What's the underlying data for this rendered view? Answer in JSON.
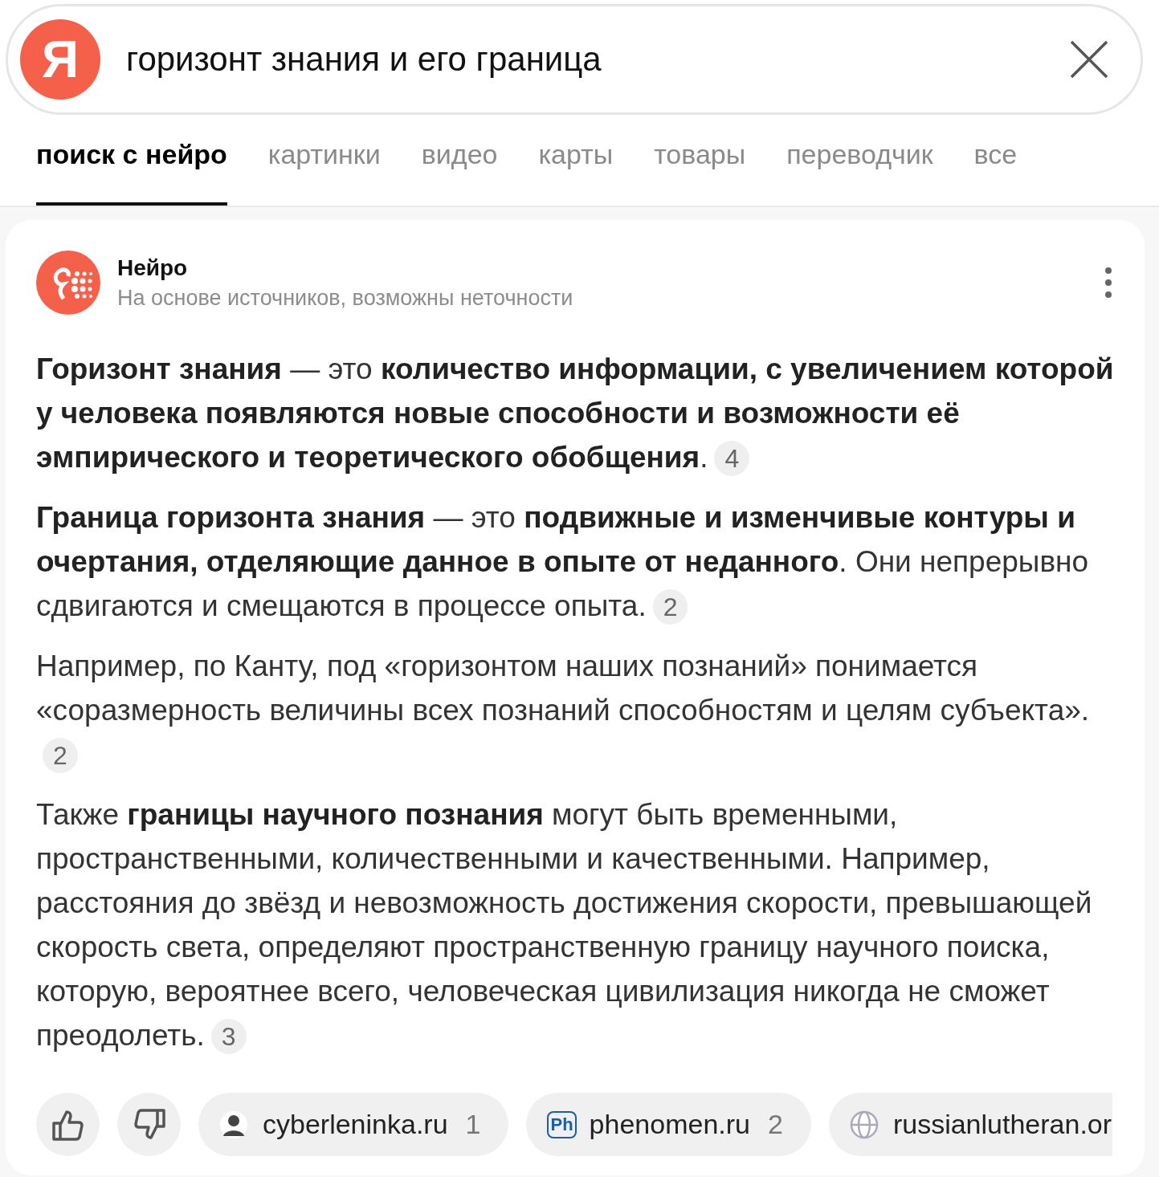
{
  "search": {
    "logo": "Я",
    "query": "горизонт знания и его граница"
  },
  "tabs": [
    {
      "label": "поиск с нейро",
      "selected": true
    },
    {
      "label": "картинки",
      "selected": false
    },
    {
      "label": "видео",
      "selected": false
    },
    {
      "label": "карты",
      "selected": false
    },
    {
      "label": "товары",
      "selected": false
    },
    {
      "label": "переводчик",
      "selected": false
    },
    {
      "label": "все",
      "selected": false
    }
  ],
  "answer": {
    "title": "Нейро",
    "subtitle": "На основе источников, возможны неточности",
    "paragraphs": [
      {
        "text": "**Горизонт знания** — это **количество информации, с увеличением которой у человека появляются новые способности и возможности её эмпирического и теоретического обобщения**.",
        "citation": "4"
      },
      {
        "text": "**Граница горизонта знания** — это **подвижные и изменчивые контуры и очертания, отделяющие данное в опыте от неданного**. Они непрерывно сдвигаются и смещаются в процессе опыта.",
        "citation": "2"
      },
      {
        "text": "Например, по Канту, под «горизонтом наших познаний» понимается «соразмерность величины всех познаний способностям и целям субъекта».",
        "citation": "2"
      },
      {
        "text": "Также **границы научного познания** могут быть временными, пространственными, количественными и качественными. Например, расстояния до звёзд и невозможность достижения скорости, превышающей скорость света, определяют пространственную границу научного поиска, которую, вероятнее всего, человеческая цивилизация никогда не сможет преодолеть.",
        "citation": "3"
      }
    ],
    "sources": [
      {
        "kind": "figure",
        "domain": "cyberleninka.ru",
        "count": "1"
      },
      {
        "kind": "badge",
        "badge": "Ph",
        "domain": "phenomen.ru",
        "count": "2"
      },
      {
        "kind": "globe",
        "domain": "russianlutheran.or"
      }
    ]
  }
}
